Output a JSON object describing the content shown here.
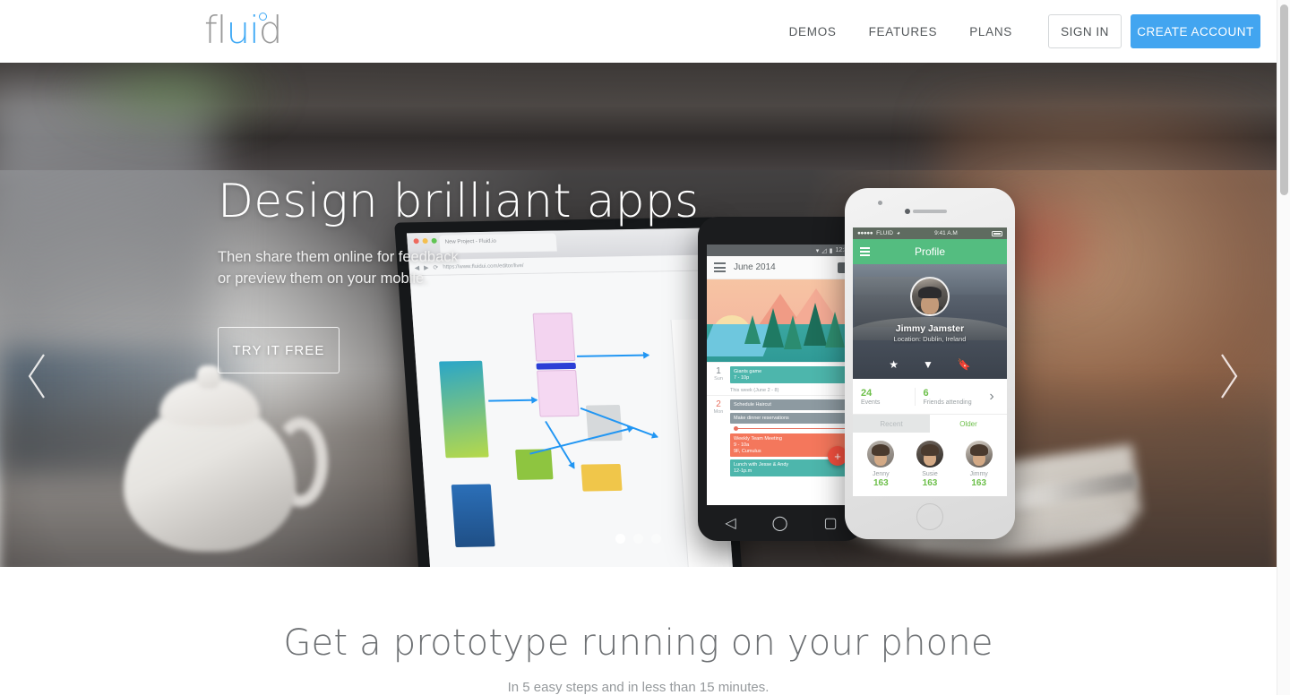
{
  "header": {
    "logo": {
      "part1": "fl",
      "part2": "ui",
      "part3": "d",
      "accent_color": "#3fa9f5",
      "gray_color": "#9a9a9a"
    },
    "nav": [
      {
        "label": "DEMOS",
        "name": "nav-demos"
      },
      {
        "label": "FEATURES",
        "name": "nav-features"
      },
      {
        "label": "PLANS",
        "name": "nav-plans"
      }
    ],
    "sign_in_label": "SIGN IN",
    "create_account_label": "CREATE ACCOUNT",
    "create_account_color": "#42a5f0"
  },
  "hero": {
    "title": "Design brilliant apps",
    "subtitle_line1": "Then share them online for feedback",
    "subtitle_line2": "or preview them on your mobile.",
    "cta_label": "TRY IT FREE",
    "prev_arrow": "‹",
    "next_arrow": "›",
    "carousel": {
      "total": 3,
      "active_index": 0
    }
  },
  "devices": {
    "laptop": {
      "tab_title": "New Project - Fluid.io",
      "url": "https://www.fluidui.com/editor/live/"
    },
    "android": {
      "status_time": "12:30",
      "month": "June 2014",
      "days": [
        {
          "num": "1",
          "weekday": "Sun",
          "highlight": false,
          "events": [
            {
              "title": "Giants game",
              "time": "7 - 10p",
              "color": "teal"
            }
          ]
        },
        {
          "num": "2",
          "weekday": "Mon",
          "highlight": true,
          "events": [
            {
              "title": "Schedule Haircut",
              "time": "",
              "color": "gray"
            },
            {
              "title": "Make dinner reservations",
              "time": "",
              "color": "gray"
            },
            {
              "title": "Weekly Team Meeting",
              "time": "9 - 10a",
              "sub": "9F, Cumulus",
              "color": "coral"
            },
            {
              "title": "Lunch with Jesse & Andy",
              "time": "12-1p.m",
              "color": "teal"
            }
          ]
        }
      ],
      "week_label": "This week (June 2 - 8)",
      "fab_label": "+"
    },
    "iphone": {
      "carrier": "FLUID",
      "time": "9:41 A.M",
      "nav_title": "Profile",
      "user_name": "Jimmy Jamster",
      "user_location": "Location: Dublin, Ireland",
      "action_icons": [
        "star-icon",
        "filter-icon",
        "bookmark-icon"
      ],
      "stats": [
        {
          "number": "24",
          "label": "Events"
        },
        {
          "number": "6",
          "label": "Friends attending"
        }
      ],
      "tabs": [
        {
          "label": "Recent",
          "active": false
        },
        {
          "label": "Older",
          "active": true
        }
      ],
      "friends": [
        {
          "name": "Jenny",
          "count": "163"
        },
        {
          "name": "Susie",
          "count": "163"
        },
        {
          "name": "Jimmy",
          "count": "163"
        }
      ],
      "accent_green": "#6cbf49",
      "navbar_green": "#54bd80"
    }
  },
  "lower": {
    "heading": "Get a prototype running on your phone",
    "subheading": "In 5 easy steps and in less than 15 minutes."
  }
}
